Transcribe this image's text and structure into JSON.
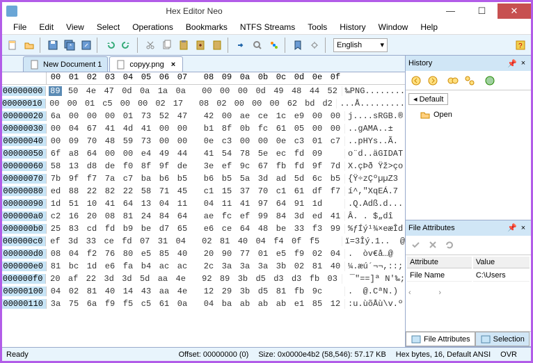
{
  "title": "Hex Editor Neo",
  "menu": [
    "File",
    "Edit",
    "View",
    "Select",
    "Operations",
    "Bookmarks",
    "NTFS Streams",
    "Tools",
    "History",
    "Window",
    "Help"
  ],
  "language": "English",
  "tabs": [
    {
      "label": "New Document 1",
      "close": true
    },
    {
      "label": "copyy.png",
      "close": true
    }
  ],
  "hex_header": [
    "00",
    "01",
    "02",
    "03",
    "04",
    "05",
    "06",
    "07",
    "08",
    "09",
    "0a",
    "0b",
    "0c",
    "0d",
    "0e",
    "0f"
  ],
  "rows": [
    {
      "off": "00000000",
      "b": [
        "89",
        "50",
        "4e",
        "47",
        "0d",
        "0a",
        "1a",
        "0a",
        "00",
        "00",
        "00",
        "0d",
        "49",
        "48",
        "44",
        "52"
      ],
      "a": "‰PNG........"
    },
    {
      "off": "00000010",
      "b": [
        "00",
        "00",
        "01",
        "c5",
        "00",
        "00",
        "02",
        "17",
        "08",
        "02",
        "00",
        "00",
        "00",
        "62",
        "bd",
        "d2"
      ],
      "a": "...Å........."
    },
    {
      "off": "00000020",
      "b": [
        "6a",
        "00",
        "00",
        "00",
        "01",
        "73",
        "52",
        "47",
        "42",
        "00",
        "ae",
        "ce",
        "1c",
        "e9",
        "00",
        "00"
      ],
      "a": "j....sRGB.®"
    },
    {
      "off": "00000030",
      "b": [
        "00",
        "04",
        "67",
        "41",
        "4d",
        "41",
        "00",
        "00",
        "b1",
        "8f",
        "0b",
        "fc",
        "61",
        "05",
        "00",
        "00"
      ],
      "a": "..gAMA..±  "
    },
    {
      "off": "00000040",
      "b": [
        "00",
        "09",
        "70",
        "48",
        "59",
        "73",
        "00",
        "00",
        "0e",
        "c3",
        "00",
        "00",
        "0e",
        "c3",
        "01",
        "c7"
      ],
      "a": "..pHYs..Ã."
    },
    {
      "off": "00000050",
      "b": [
        "6f",
        "a8",
        "64",
        "00",
        "00",
        "e4",
        "49",
        "44",
        "41",
        "54",
        "78",
        "5e",
        "ec",
        "fd",
        "09"
      ],
      "a": "o¨d..äGIDAT"
    },
    {
      "off": "00000060",
      "b": [
        "58",
        "13",
        "d8",
        "de",
        "f0",
        "8f",
        "9f",
        "de",
        "3e",
        "ef",
        "9c",
        "67",
        "fb",
        "fd",
        "9f",
        "7d"
      ],
      "a": "X.çÞð Ÿž>ço"
    },
    {
      "off": "00000070",
      "b": [
        "7b",
        "9f",
        "f7",
        "7a",
        "c7",
        "ba",
        "b6",
        "b5",
        "b6",
        "b5",
        "5a",
        "3d",
        "ad",
        "5d",
        "6c",
        "b5"
      ],
      "a": "{Ÿ÷zÇºµµZ3"
    },
    {
      "off": "00000080",
      "b": [
        "ed",
        "88",
        "22",
        "82",
        "22",
        "58",
        "71",
        "45",
        "c1",
        "15",
        "37",
        "70",
        "c1",
        "61",
        "df",
        "f7"
      ],
      "a": "í^,\"XqEÁ.7"
    },
    {
      "off": "00000090",
      "b": [
        "1d",
        "51",
        "10",
        "41",
        "64",
        "13",
        "04",
        "11",
        "04",
        "11",
        "41",
        "97",
        "64",
        "91",
        "1d"
      ],
      "a": ".Q.Adß.d..."
    },
    {
      "off": "000000a0",
      "b": [
        "c2",
        "16",
        "20",
        "08",
        "81",
        "24",
        "84",
        "64",
        "ae",
        "fc",
        "ef",
        "99",
        "84",
        "3d",
        "ed",
        "41"
      ],
      "a": "Â. . $„dî"
    },
    {
      "off": "000000b0",
      "b": [
        "25",
        "83",
        "cd",
        "fd",
        "b9",
        "be",
        "d7",
        "65",
        "e6",
        "ce",
        "64",
        "48",
        "be",
        "33",
        "f3",
        "99"
      ],
      "a": "%ƒÍý¹¾×eæÎd"
    },
    {
      "off": "000000c0",
      "b": [
        "ef",
        "3d",
        "33",
        "ce",
        "fd",
        "07",
        "31",
        "04",
        "02",
        "81",
        "40",
        "04",
        "f4",
        "0f",
        "f5"
      ],
      "a": "ï=3Îý.1..  @"
    },
    {
      "off": "000000d0",
      "b": [
        "08",
        "04",
        "f2",
        "76",
        "80",
        "e5",
        "85",
        "40",
        "20",
        "90",
        "77",
        "01",
        "e5",
        "f9",
        "02",
        "04"
      ],
      "a": ".  òv€å…@ "
    },
    {
      "off": "000000e0",
      "b": [
        "81",
        "bc",
        "1d",
        "e6",
        "fa",
        "b4",
        "ac",
        "ac",
        "2c",
        "3a",
        "3a",
        "3a",
        "3b",
        "02",
        "81",
        "40"
      ],
      "a": "¼.æú´¬¬,::;"
    },
    {
      "off": "000000f0",
      "b": [
        "20",
        "af",
        "22",
        "3d",
        "3d",
        "5d",
        "aa",
        "4e",
        "92",
        "89",
        "3b",
        "d5",
        "d3",
        "d3",
        "fb",
        "03"
      ],
      "a": " ¯\"==]ª N'‰;"
    },
    {
      "off": "00000100",
      "b": [
        "04",
        "02",
        "81",
        "40",
        "14",
        "43",
        "aa",
        "4e",
        "12",
        "29",
        "3b",
        "d5",
        "81",
        "fb",
        "9c"
      ],
      "a": ".  @.CªN.)"
    },
    {
      "off": "00000110",
      "b": [
        "3a",
        "75",
        "6a",
        "f9",
        "f5",
        "c5",
        "61",
        "0a",
        "04",
        "ba",
        "ab",
        "ab",
        "ab",
        "e1",
        "85",
        "12"
      ],
      "a": ":u.ùõÅù\\v.º"
    }
  ],
  "history_panel": {
    "title": "History",
    "tab": "Default",
    "item": "Open"
  },
  "attr_panel": {
    "title": "File Attributes",
    "cols": [
      "Attribute",
      "Value"
    ],
    "rows": [
      [
        "File Name",
        "C:\\Users"
      ]
    ],
    "tabs": [
      "File Attributes",
      "Selection"
    ]
  },
  "status": {
    "ready": "Ready",
    "offset": "Offset: 00000000 (0)",
    "size": "Size: 0x0000e4b2 (58,546): 57.17 KB",
    "mode": "Hex bytes, 16, Default ANSI",
    "ovr": "OVR"
  }
}
